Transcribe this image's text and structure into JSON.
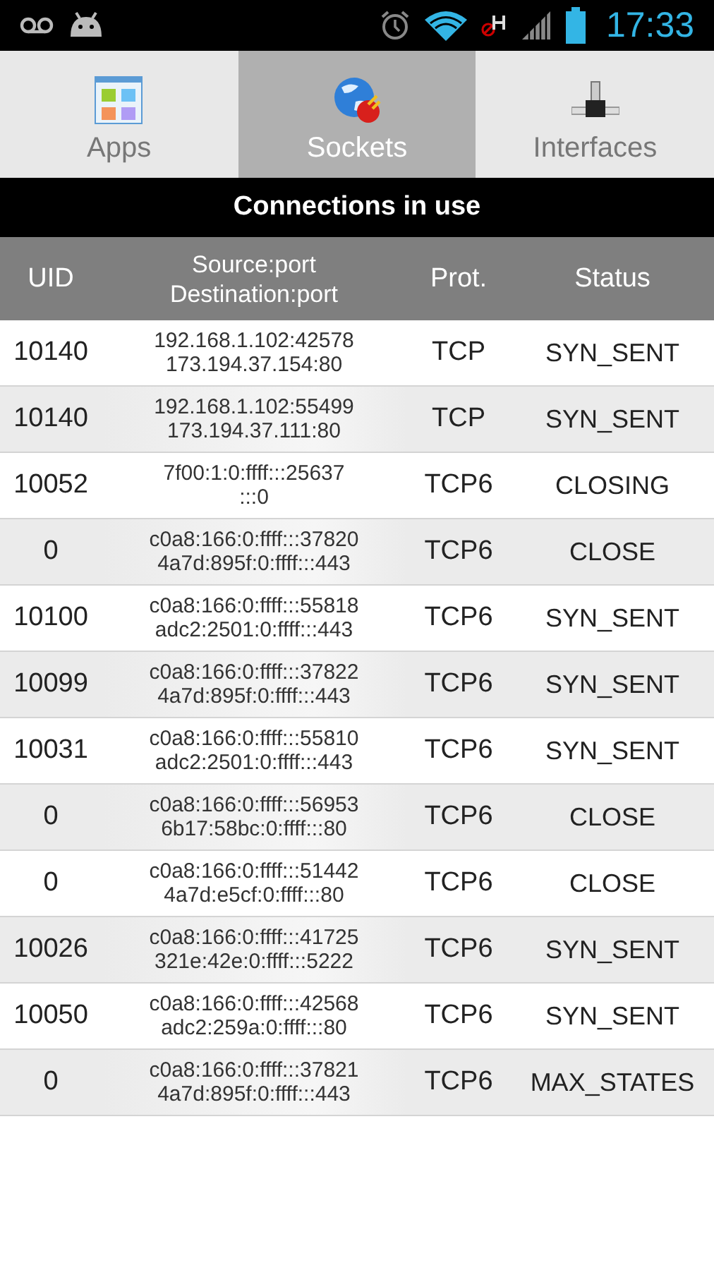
{
  "status_bar": {
    "time": "17:33"
  },
  "tabs": [
    {
      "label": "Apps",
      "kind": "apps",
      "selected": false
    },
    {
      "label": "Sockets",
      "kind": "sockets",
      "selected": true
    },
    {
      "label": "Interfaces",
      "kind": "interfaces",
      "selected": false
    }
  ],
  "title": "Connections in use",
  "table": {
    "columns": [
      "UID",
      "Source:port\nDestination:port",
      "Prot.",
      "Status"
    ],
    "rows": [
      {
        "uid": "10140",
        "address": "192.168.1.102:42578\n173.194.37.154:80",
        "protocol": "TCP",
        "status": "SYN_SENT"
      },
      {
        "uid": "10140",
        "address": "192.168.1.102:55499\n173.194.37.111:80",
        "protocol": "TCP",
        "status": "SYN_SENT"
      },
      {
        "uid": "10052",
        "address": "7f00:1:0:ffff:::25637\n:::0",
        "protocol": "TCP6",
        "status": "CLOSING"
      },
      {
        "uid": "0",
        "address": "c0a8:166:0:ffff:::37820\n4a7d:895f:0:ffff:::443",
        "protocol": "TCP6",
        "status": "CLOSE"
      },
      {
        "uid": "10100",
        "address": "c0a8:166:0:ffff:::55818\nadc2:2501:0:ffff:::443",
        "protocol": "TCP6",
        "status": "SYN_SENT"
      },
      {
        "uid": "10099",
        "address": "c0a8:166:0:ffff:::37822\n4a7d:895f:0:ffff:::443",
        "protocol": "TCP6",
        "status": "SYN_SENT"
      },
      {
        "uid": "10031",
        "address": "c0a8:166:0:ffff:::55810\nadc2:2501:0:ffff:::443",
        "protocol": "TCP6",
        "status": "SYN_SENT"
      },
      {
        "uid": "0",
        "address": "c0a8:166:0:ffff:::56953\n6b17:58bc:0:ffff:::80",
        "protocol": "TCP6",
        "status": "CLOSE"
      },
      {
        "uid": "0",
        "address": "c0a8:166:0:ffff:::51442\n4a7d:e5cf:0:ffff:::80",
        "protocol": "TCP6",
        "status": "CLOSE"
      },
      {
        "uid": "10026",
        "address": "c0a8:166:0:ffff:::41725\n321e:42e:0:ffff:::5222",
        "protocol": "TCP6",
        "status": "SYN_SENT"
      },
      {
        "uid": "10050",
        "address": "c0a8:166:0:ffff:::42568\nadc2:259a:0:ffff:::80",
        "protocol": "TCP6",
        "status": "SYN_SENT"
      },
      {
        "uid": "0",
        "address": "c0a8:166:0:ffff:::37821\n4a7d:895f:0:ffff:::443",
        "protocol": "TCP6",
        "status": "MAX_STATES"
      }
    ]
  }
}
